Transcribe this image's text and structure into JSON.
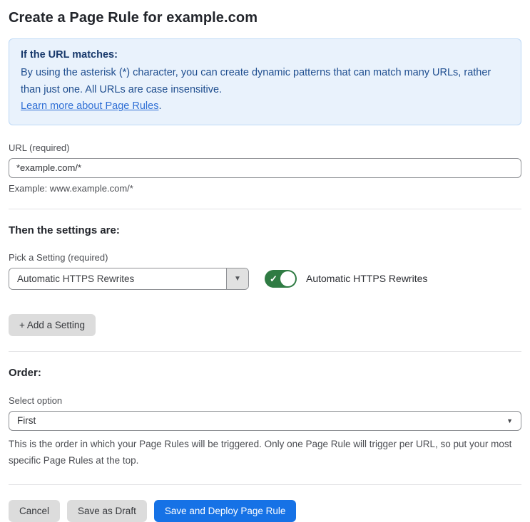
{
  "page": {
    "title": "Create a Page Rule for example.com"
  },
  "info_box": {
    "heading": "If the URL matches:",
    "body": "By using the asterisk (*) character, you can create dynamic patterns that can match many URLs, rather than just one. All URLs are case insensitive.",
    "link_label": "Learn more about Page Rules",
    "link_suffix": "."
  },
  "url_field": {
    "label": "URL (required)",
    "value": "*example.com/*",
    "example": "Example: www.example.com/*"
  },
  "settings": {
    "heading": "Then the settings are:",
    "pick_label": "Pick a Setting (required)",
    "selected_setting": "Automatic HTTPS Rewrites",
    "dropdown_chevron": "▼",
    "toggle_label": "Automatic HTTPS Rewrites",
    "toggle_state": "on",
    "toggle_check": "✓",
    "add_button_label": "+ Add a Setting"
  },
  "order": {
    "heading": "Order:",
    "label": "Select option",
    "selected_option": "First",
    "chevron": "▼",
    "help": "This is the order in which your Page Rules will be triggered. Only one Page Rule will trigger per URL, so put your most specific Page Rules at the top."
  },
  "footer": {
    "cancel_label": "Cancel",
    "save_draft_label": "Save as Draft",
    "save_deploy_label": "Save and Deploy Page Rule"
  },
  "colors": {
    "accent_blue": "#1672e6",
    "toggle_green": "#2f7b43",
    "info_bg": "#e9f2fc",
    "info_border": "#bed9f6",
    "info_heading_text": "#17386b",
    "info_body_text": "#1f4e8f",
    "link_blue": "#2f6fd5",
    "button_gray": "#dcdcdc"
  }
}
